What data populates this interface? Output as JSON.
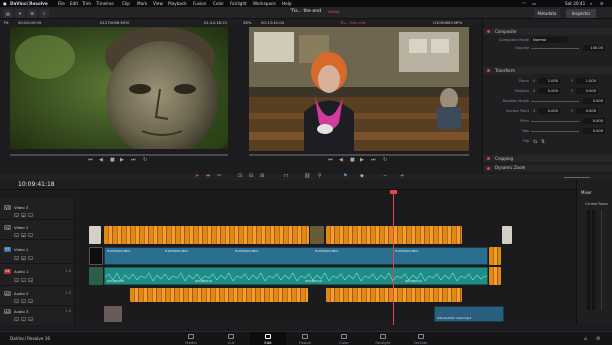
{
  "macbar": {
    "app_name": "DaVinci Resolve",
    "menus": [
      "File",
      "Edit",
      "Trim",
      "Timeline",
      "Clip",
      "Mark",
      "View",
      "Playback",
      "Fusion",
      "Color",
      "Fairlight",
      "Workspace",
      "Help"
    ],
    "clock": "Sat 20:41"
  },
  "toolbar": {
    "project_title": "'Tis... the end",
    "edited": "Edited",
    "metadata": "Metadata",
    "inspector": "Inspector"
  },
  "source_viewer": {
    "zoom": "Fit",
    "timecode": "00:00:00:09",
    "clip_name": "01270056.MOV",
    "duration": "01:24:18:21"
  },
  "timeline_viewer": {
    "zoom": "36%",
    "timecode": "00:13:42:04",
    "title": "Tis... this end",
    "clip_name": "H1050605.MP4"
  },
  "inspector": {
    "sections": [
      {
        "name": "Composite",
        "rows": [
          {
            "label": "Composite Mode",
            "value": "Normal"
          },
          {
            "label": "Opacity",
            "value": "100.00"
          }
        ]
      },
      {
        "name": "Transform",
        "rows": [
          {
            "label": "Zoom",
            "x_label": "X",
            "x": "1.000",
            "y_label": "Y",
            "y": "1.000"
          },
          {
            "label": "Position",
            "x_label": "X",
            "x": "0.000",
            "y_label": "Y",
            "y": "0.000"
          },
          {
            "label": "Rotation Angle",
            "value": "0.000"
          },
          {
            "label": "Anchor Point",
            "x_label": "X",
            "x": "0.000",
            "y_label": "Y",
            "y": "0.000"
          },
          {
            "label": "Pitch",
            "value": "0.000"
          },
          {
            "label": "Yaw",
            "value": "0.000"
          },
          {
            "label": "Flip",
            "value": ""
          }
        ]
      },
      {
        "name": "Cropping",
        "rows": []
      },
      {
        "name": "Dynamic Zoom",
        "rows": []
      }
    ]
  },
  "timeline": {
    "timecode": "10:09:41:18",
    "ruler_ticks": [
      "01:00:00:00",
      "01:01:28:00",
      "01:02:56:00",
      "01:04:24:00",
      "01:05:52:00",
      "01:07:20:00",
      "01:08:48:00"
    ],
    "tracks": [
      {
        "tag": "V3",
        "name": "Video 3",
        "type": "video",
        "count": ""
      },
      {
        "tag": "V2",
        "name": "Video 2",
        "type": "video",
        "count": ""
      },
      {
        "tag": "V1",
        "name": "Video 1",
        "type": "video",
        "count": ""
      },
      {
        "tag": "A1",
        "name": "Audio 1",
        "type": "audio",
        "count": "1.0"
      },
      {
        "tag": "A2",
        "name": "Audio 2",
        "type": "audio",
        "count": "1.0"
      },
      {
        "tag": "A3",
        "name": "Audio 3",
        "type": "audio",
        "count": "1.0"
      }
    ],
    "clip_labels": {
      "video": "H1050605.MP4",
      "audio": "ZOOM0016",
      "music": "Introduction Cello.mp3"
    }
  },
  "mixer": {
    "title": "Mixer",
    "control_room": "Control Room",
    "channels": [
      "A1",
      "A2",
      "A3",
      "M1"
    ]
  },
  "pages": [
    {
      "name": "Media",
      "active": false
    },
    {
      "name": "Cut",
      "active": false
    },
    {
      "name": "Edit",
      "active": true
    },
    {
      "name": "Fusion",
      "active": false
    },
    {
      "name": "Color",
      "active": false
    },
    {
      "name": "Fairlight",
      "active": false
    },
    {
      "name": "Deliver",
      "active": false
    }
  ],
  "footer": {
    "app_version": "DaVinci Resolve 16"
  },
  "colors": {
    "accent": "#e0464a",
    "video_clip": "#2b6f90",
    "audio_clip": "#1f8d86",
    "orange_clip": "#e08a16",
    "playhead": "#e0464a"
  }
}
